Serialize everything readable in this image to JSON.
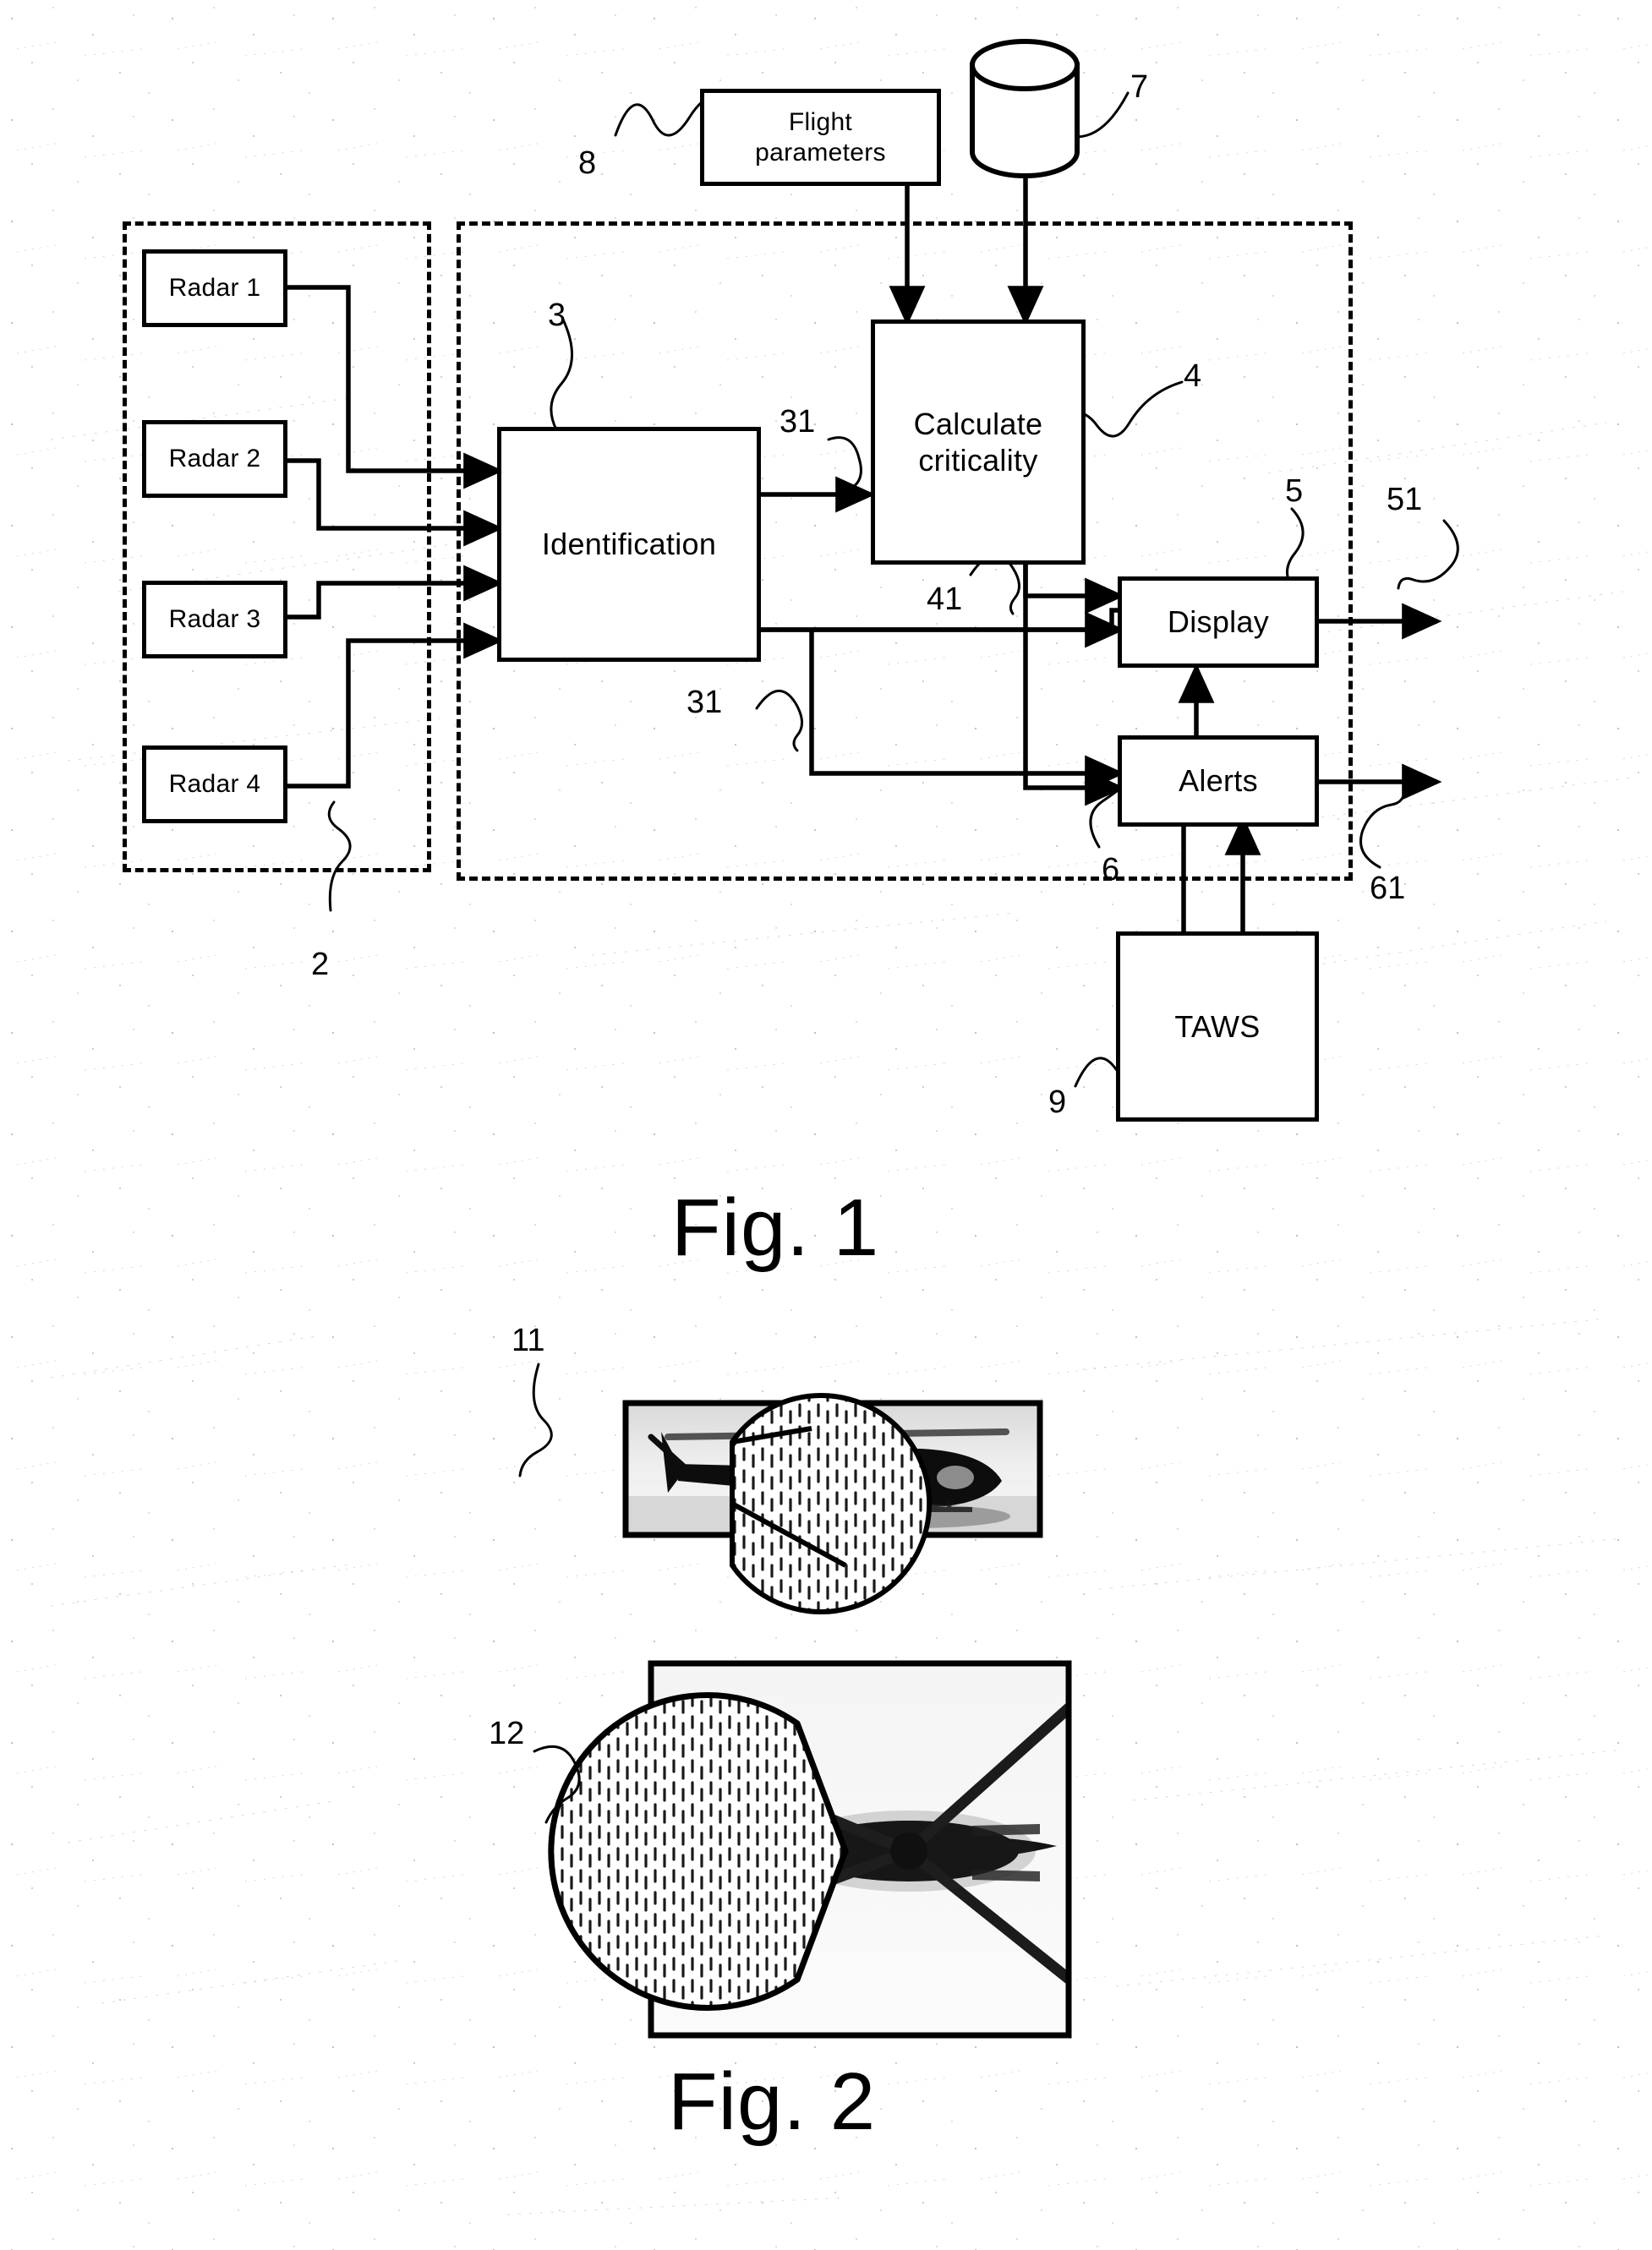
{
  "document": {
    "type": "patent-figure-sheet",
    "background_color": "#ffffff",
    "ink_color": "#000000"
  },
  "figures": [
    {
      "caption": "Fig. 1",
      "title_block": "System block diagram",
      "boxes": [
        {
          "id": "flight-parameters",
          "label": "Flight\nparameters",
          "line1": "Flight",
          "line2": "parameters",
          "ref": "8"
        },
        {
          "id": "database",
          "label": "",
          "shape": "cylinder",
          "ref": "7"
        },
        {
          "id": "radar-1",
          "label": "Radar 1"
        },
        {
          "id": "radar-2",
          "label": "Radar 2"
        },
        {
          "id": "radar-3",
          "label": "Radar 3"
        },
        {
          "id": "radar-4",
          "label": "Radar 4"
        },
        {
          "id": "identification",
          "label": "Identification",
          "ref": "3"
        },
        {
          "id": "calculate-criticality",
          "label": "Calculate\ncriticality",
          "line1": "Calculate",
          "line2": "criticality",
          "ref": "4"
        },
        {
          "id": "display",
          "label": "Display",
          "ref": "5"
        },
        {
          "id": "alerts",
          "label": "Alerts",
          "ref": "6"
        },
        {
          "id": "taws",
          "label": "TAWS",
          "ref": "9"
        }
      ],
      "reference_numerals": [
        {
          "id": "ref-8",
          "text": "8",
          "points_to": "flight-parameters"
        },
        {
          "id": "ref-7",
          "text": "7",
          "points_to": "database"
        },
        {
          "id": "ref-3",
          "text": "3",
          "points_to": "identification"
        },
        {
          "id": "ref-4",
          "text": "4",
          "points_to": "calculate-criticality"
        },
        {
          "id": "ref-31-upper",
          "text": "31",
          "points_to": "identification-to-criticality-link"
        },
        {
          "id": "ref-31-lower",
          "text": "31",
          "points_to": "identification-to-alerts-link"
        },
        {
          "id": "ref-41",
          "text": "41",
          "points_to": "criticality-to-display-link"
        },
        {
          "id": "ref-5",
          "text": "5",
          "points_to": "display"
        },
        {
          "id": "ref-51",
          "text": "51",
          "points_to": "display-output"
        },
        {
          "id": "ref-6",
          "text": "6",
          "points_to": "alerts"
        },
        {
          "id": "ref-61",
          "text": "61",
          "points_to": "alerts-output"
        },
        {
          "id": "ref-9",
          "text": "9",
          "points_to": "taws"
        },
        {
          "id": "ref-2",
          "text": "2",
          "points_to": "radar-group-boundary"
        }
      ],
      "dashed_regions": [
        {
          "id": "radar-group-boundary",
          "ref": "2"
        },
        {
          "id": "processing-unit-boundary"
        }
      ]
    },
    {
      "caption": "Fig. 2",
      "title_block": "Obstacle detection coverage illustrations",
      "panels": [
        {
          "id": "helicopter-side-view",
          "ref": "11",
          "description": "helicopter side view photograph with hatched sector overlay"
        },
        {
          "id": "helicopter-top-view",
          "ref": "12",
          "description": "helicopter top view photograph with hatched sector overlay"
        }
      ],
      "reference_numerals": [
        {
          "id": "ref-11",
          "text": "11",
          "points_to": "helicopter-side-view"
        },
        {
          "id": "ref-12",
          "text": "12",
          "points_to": "helicopter-top-view"
        }
      ]
    }
  ],
  "captions": {
    "fig1": "Fig. 1",
    "fig2": "Fig. 2"
  },
  "labels": {
    "flight_parameters_line1": "Flight",
    "flight_parameters_line2": "parameters",
    "radar_1": "Radar 1",
    "radar_2": "Radar 2",
    "radar_3": "Radar 3",
    "radar_4": "Radar 4",
    "identification": "Identification",
    "calculate_line1": "Calculate",
    "calculate_line2": "criticality",
    "display": "Display",
    "alerts": "Alerts",
    "taws": "TAWS"
  },
  "refs": {
    "n2": "2",
    "n3": "3",
    "n4": "4",
    "n5": "5",
    "n6": "6",
    "n7": "7",
    "n8": "8",
    "n9": "9",
    "n11": "11",
    "n12": "12",
    "n31a": "31",
    "n31b": "31",
    "n41": "41",
    "n51": "51",
    "n61": "61"
  }
}
